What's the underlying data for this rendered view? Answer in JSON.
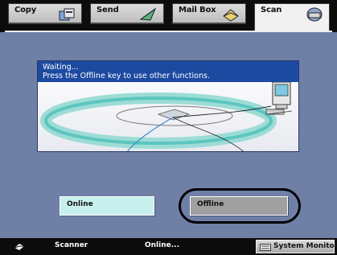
{
  "tabs": [
    {
      "label": "Copy",
      "icon": "copy-icon"
    },
    {
      "label": "Send",
      "icon": "send-icon"
    },
    {
      "label": "Mail Box",
      "icon": "mailbox-icon"
    },
    {
      "label": "Scan",
      "icon": "scan-icon",
      "active": true
    }
  ],
  "dialog": {
    "line1": "Waiting...",
    "line2": "Press the Offline key to use other functions."
  },
  "buttons": {
    "online": "Online",
    "offline": "Offline"
  },
  "status": {
    "mode": "Scanner",
    "state": "Online...",
    "system_monitor": "System Monitor"
  },
  "colors": {
    "background": "#6f7fa6",
    "message_bar": "#1c4aa0",
    "online_button": "#c8f0ec",
    "offline_button": "#a0a0a0"
  }
}
